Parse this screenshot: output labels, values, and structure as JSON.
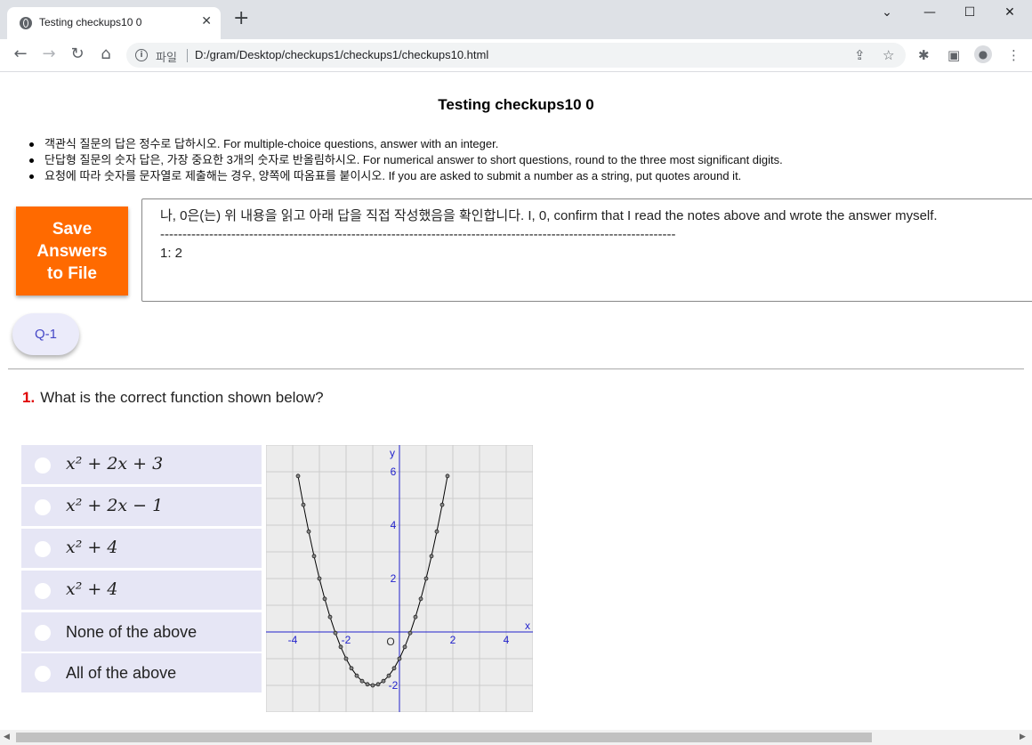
{
  "browser": {
    "tab_title": "Testing checkups10 0",
    "close_glyph": "✕",
    "new_tab_glyph": "+",
    "protocol_label": "파일",
    "url": "D:/gram/Desktop/checkups1/checkups1/checkups10.html",
    "window_controls": {
      "dropdown": "⌄",
      "minimize": "—",
      "maximize": "☐",
      "close": "✕"
    }
  },
  "page": {
    "title": "Testing checkups10 0",
    "notes": [
      "객관식 질문의 답은 정수로 답하시오. For multiple-choice questions, answer with an integer.",
      "단답형 질문의 숫자 답은, 가장 중요한 3개의 숫자로 반올림하시오. For numerical answer to short questions, round to the three most significant digits.",
      "요청에 따라 숫자를 문자열로 제출해는 경우, 양쪽에 따옴표를 붙이시오. If you are asked to submit a number as a string, put quotes around it."
    ],
    "save_button": "Save Answers to File",
    "answer_box": {
      "confirm_line": "나, 0은(는) 위 내용을 읽고 아래 답을 직접 작성했음을 확인합니다. I, 0, confirm that I read the notes above and wrote the answer myself.",
      "divider": "--------------------------------------------------------------------------------------------------------------------",
      "answer_line": "1: 2"
    },
    "question_nav": [
      "Q-1"
    ],
    "question": {
      "number": "1.",
      "text": "What is the correct function shown below?",
      "options": [
        "x² + 2x + 3",
        "x² + 2x − 1",
        "x² + 4",
        "x² + 4",
        "None of the above",
        "All of the above"
      ]
    }
  },
  "chart_data": {
    "type": "line",
    "function": "x^2 + 2x - 1",
    "xlabel": "x",
    "ylabel": "y",
    "origin_label": "O",
    "xlim": [
      -5,
      5
    ],
    "ylim": [
      -3,
      7
    ],
    "x_ticks": [
      "-4",
      "-2",
      "2",
      "4"
    ],
    "y_ticks": [
      "6",
      "4",
      "2",
      "-2"
    ],
    "grid": true,
    "series": [
      {
        "x": [
          -3.8,
          -3.6,
          -3.4,
          -3.2,
          -3.0,
          -2.8,
          -2.6,
          -2.4,
          -2.2,
          -2.0,
          -1.8,
          -1.6,
          -1.4,
          -1.2,
          -1.0,
          -0.8,
          -0.6,
          -0.4,
          -0.2,
          0.0,
          0.2,
          0.4,
          0.6,
          0.8,
          1.0,
          1.2,
          1.4,
          1.6,
          1.8
        ],
        "y": [
          5.84,
          4.76,
          3.76,
          2.84,
          2.0,
          1.24,
          0.56,
          -0.04,
          -0.56,
          -1.0,
          -1.36,
          -1.64,
          -1.84,
          -1.96,
          -2.0,
          -1.96,
          -1.84,
          -1.64,
          -1.36,
          -1.0,
          -0.56,
          -0.04,
          0.56,
          1.24,
          2.0,
          2.84,
          3.76,
          4.76,
          5.84
        ]
      }
    ],
    "colors": {
      "axis": "#2222cc",
      "curve": "#000000",
      "grid": "#cccccc",
      "background": "#ececec"
    }
  }
}
